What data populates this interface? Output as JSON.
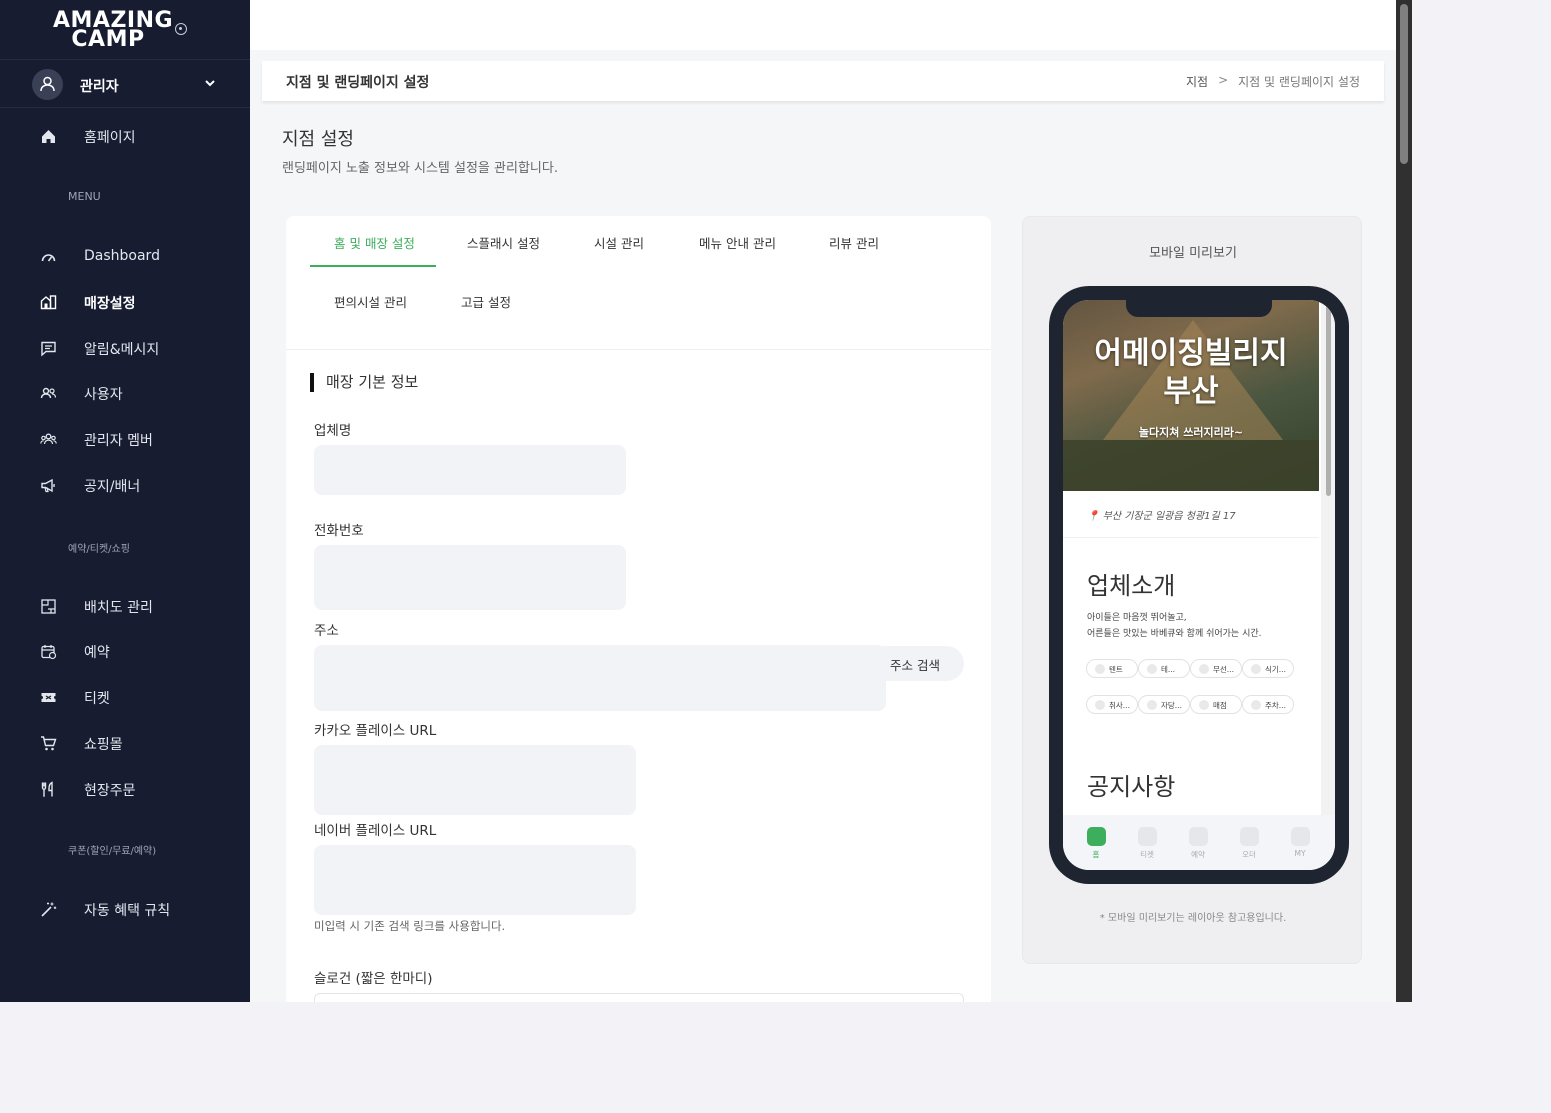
{
  "brand": {
    "logo_line1": "AMAZING",
    "logo_line2": "CAMP"
  },
  "user": {
    "name": "관리자"
  },
  "sidebar": {
    "home": "홈페이지",
    "section_menu": "MENU",
    "items": [
      {
        "label": "Dashboard",
        "icon": "speedometer-icon"
      },
      {
        "label": "매장설정",
        "icon": "store-icon",
        "active": true
      },
      {
        "label": "알림&메시지",
        "icon": "message-icon"
      },
      {
        "label": "사용자",
        "icon": "users-icon"
      },
      {
        "label": "관리자 멤버",
        "icon": "team-icon"
      },
      {
        "label": "공지/배너",
        "icon": "megaphone-icon"
      }
    ],
    "section_booking": "예약/티켓/쇼핑",
    "items2": [
      {
        "label": "배치도 관리",
        "icon": "layout-icon"
      },
      {
        "label": "예약",
        "icon": "calendar-icon"
      },
      {
        "label": "티켓",
        "icon": "ticket-icon"
      },
      {
        "label": "쇼핑몰",
        "icon": "cart-icon"
      },
      {
        "label": "현장주문",
        "icon": "utensils-icon"
      }
    ],
    "section_coupon": "쿠폰(할인/무료/예약)",
    "items3": [
      {
        "label": "자동 혜택 규칙",
        "icon": "magic-wand-icon"
      }
    ]
  },
  "breadcrumb": {
    "title": "지점 및 랜딩페이지 설정",
    "parent": "지점",
    "separator": ">",
    "current": "지점 및 랜딩페이지 설정"
  },
  "page": {
    "title": "지점 설정",
    "subtitle": "랜딩페이지 노출 정보와 시스템 설정을 관리합니다."
  },
  "tabs": [
    "홈 및 매장 설정",
    "스플래시 설정",
    "시설 관리",
    "메뉴 안내 관리",
    "리뷰 관리",
    "편의시설 관리",
    "고급 설정"
  ],
  "form": {
    "section_title": "매장 기본 정보",
    "company_label": "업체명",
    "phone_label": "전화번호",
    "address_label": "주소",
    "address_search": "주소 검색",
    "kakao_label": "카카오 플레이스 URL",
    "naver_label": "네이버 플레이스 URL",
    "naver_hint": "미입력 시 기존 검색 링크를 사용합니다.",
    "slogan_label": "슬로건 (짧은 한마디)"
  },
  "preview": {
    "title": "모바일 미리보기",
    "hero_title_1": "어메이징빌리지",
    "hero_title_2": "부산",
    "hero_sub": "놀다지쳐 쓰러지리라~",
    "location": "📍 부산 기장군 일광읍 청광1길 17",
    "intro_heading": "업체소개",
    "intro_line1": "아이들은 마음껏 뛰어놀고,",
    "intro_line2": "어른들은 맛있는 바베큐와 함께 쉬어가는 시간.",
    "chips": [
      "텐트",
      "테...",
      "무선...",
      "식기...",
      "취사...",
      "자당...",
      "매점",
      "주차..."
    ],
    "notice_heading": "공지사항",
    "tabbar": [
      {
        "label": "홈",
        "icon": "home-icon",
        "active": true
      },
      {
        "label": "티켓",
        "icon": "ticket-icon"
      },
      {
        "label": "예약",
        "icon": "calendar-icon"
      },
      {
        "label": "오더",
        "icon": "order-icon"
      },
      {
        "label": "MY",
        "icon": "user-icon"
      }
    ],
    "note": "* 모바일 미리보기는 레이아웃 참고용입니다."
  },
  "colors": {
    "sidebar_bg": "#171c31",
    "accent_green": "#3cae5c"
  }
}
